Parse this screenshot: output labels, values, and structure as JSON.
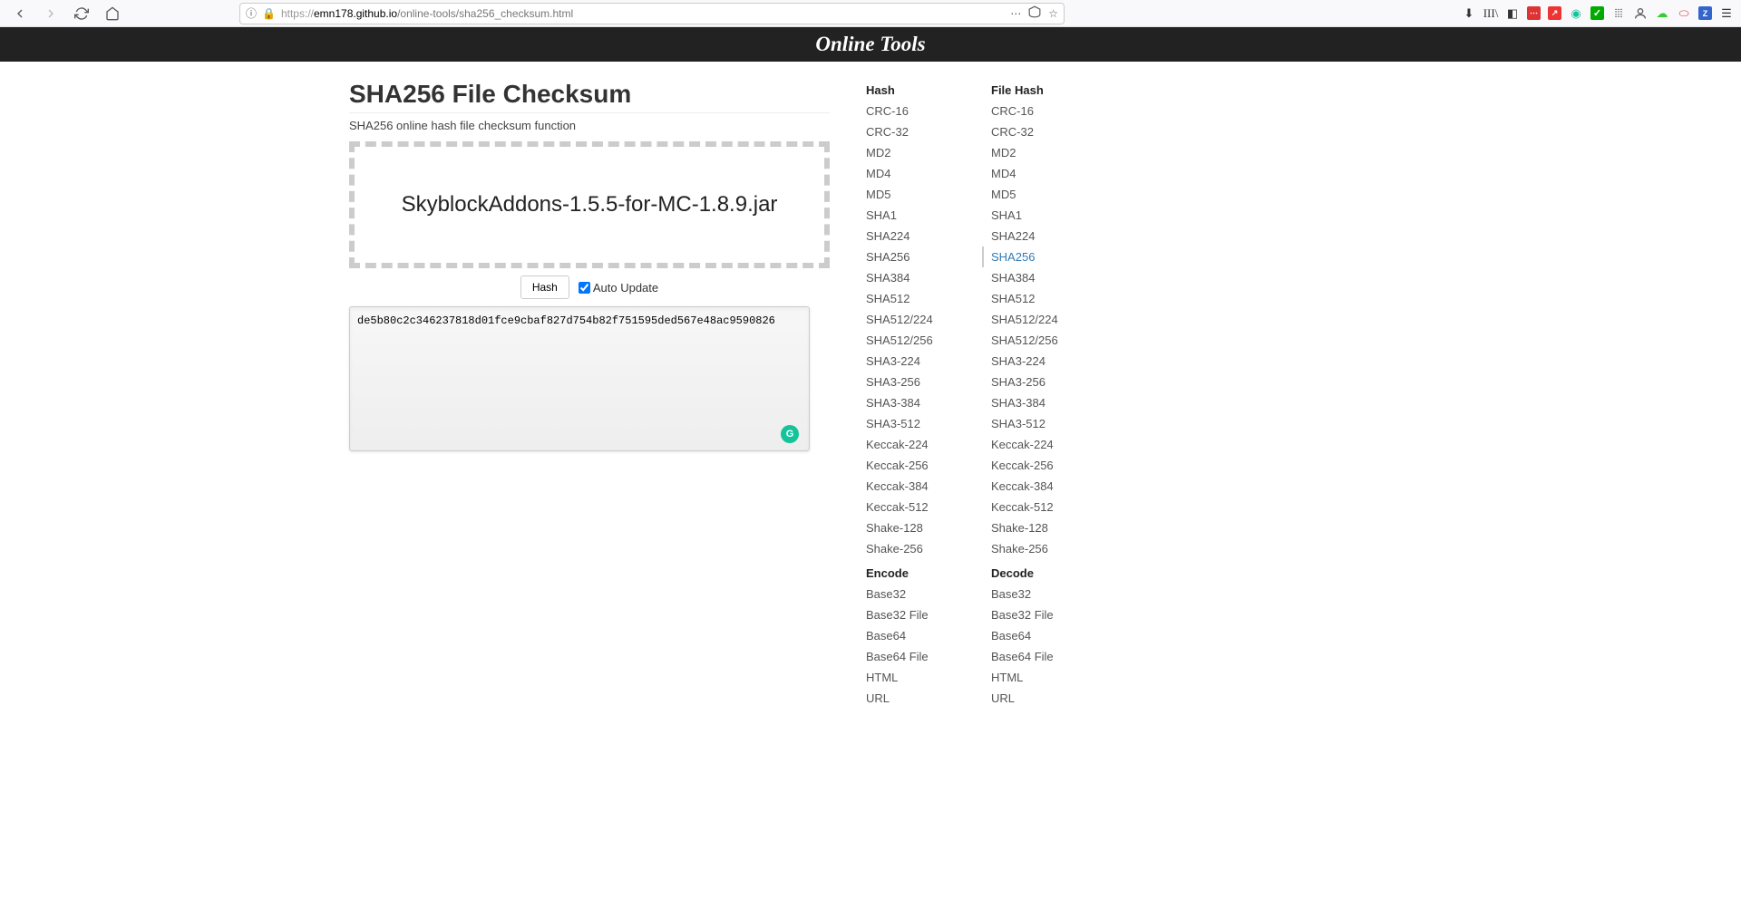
{
  "browser": {
    "url_prefix": "https://",
    "url_host": "emn178.github.io",
    "url_path": "/online-tools/sha256_checksum.html"
  },
  "banner": {
    "title": "Online Tools"
  },
  "main": {
    "title": "SHA256 File Checksum",
    "subtitle": "SHA256 online hash file checksum function",
    "dropzone_text": "SkyblockAddons-1.5.5-for-MC-1.8.9.jar",
    "hash_button": "Hash",
    "auto_update_label": "Auto Update",
    "auto_update_checked": true,
    "output_value": "de5b80c2c346237818d01fce9cbaf827d754b82f751595ded567e48ac9590826"
  },
  "sidebar": {
    "hash_header": "Hash",
    "filehash_header": "File Hash",
    "encode_header": "Encode",
    "decode_header": "Decode",
    "hash_items": [
      "CRC-16",
      "CRC-32",
      "MD2",
      "MD4",
      "MD5",
      "SHA1",
      "SHA224",
      "SHA256",
      "SHA384",
      "SHA512",
      "SHA512/224",
      "SHA512/256",
      "SHA3-224",
      "SHA3-256",
      "SHA3-384",
      "SHA3-512",
      "Keccak-224",
      "Keccak-256",
      "Keccak-384",
      "Keccak-512",
      "Shake-128",
      "Shake-256"
    ],
    "encode_items": [
      "Base32",
      "Base32 File",
      "Base64",
      "Base64 File",
      "HTML",
      "URL"
    ],
    "active_filehash": "SHA256"
  }
}
